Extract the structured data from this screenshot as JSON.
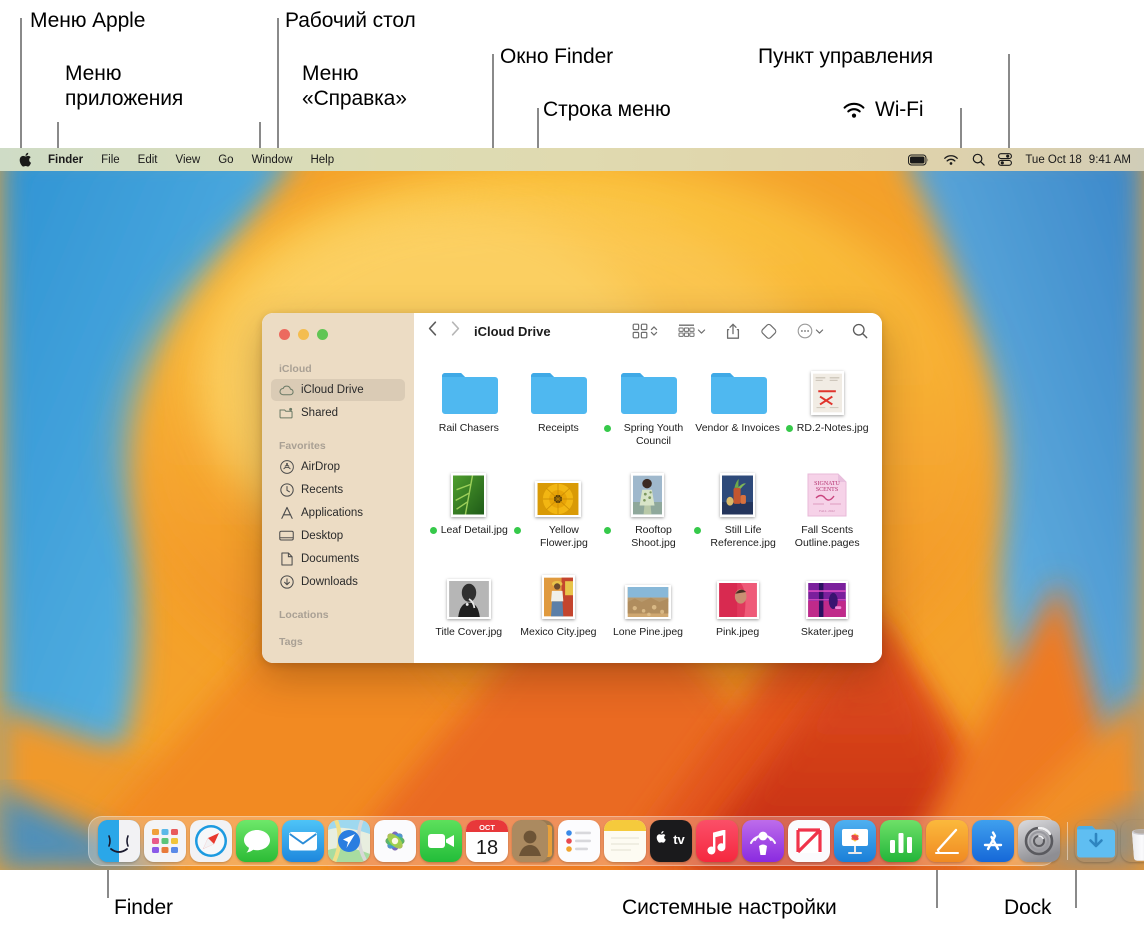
{
  "annotations": [
    {
      "id": "apple-menu",
      "text": "Меню Apple"
    },
    {
      "id": "app-menu",
      "text": "Меню\nприложения"
    },
    {
      "id": "desktop",
      "text": "Рабочий стол"
    },
    {
      "id": "help-menu",
      "text": "Меню\n«Справка»"
    },
    {
      "id": "finder-window",
      "text": "Окно Finder"
    },
    {
      "id": "menu-bar",
      "text": "Строка меню"
    },
    {
      "id": "control-center",
      "text": "Пункт управления"
    },
    {
      "id": "wifi",
      "text": "Wi-Fi"
    },
    {
      "id": "finder-dock",
      "text": "Finder"
    },
    {
      "id": "system-settings",
      "text": "Системные настройки"
    },
    {
      "id": "dock",
      "text": "Dock"
    }
  ],
  "menubar": {
    "apple_icon": "apple-logo-icon",
    "items": [
      {
        "label": "Finder",
        "bold": true
      },
      {
        "label": "File",
        "bold": false
      },
      {
        "label": "Edit",
        "bold": false
      },
      {
        "label": "View",
        "bold": false
      },
      {
        "label": "Go",
        "bold": false
      },
      {
        "label": "Window",
        "bold": false
      },
      {
        "label": "Help",
        "bold": false
      }
    ],
    "status": {
      "battery_icon": "battery-icon",
      "wifi_icon": "wifi-icon",
      "search_icon": "spotlight-search-icon",
      "control_center_icon": "control-center-icon",
      "date": "Tue Oct 18",
      "time": "9:41 AM"
    }
  },
  "finder": {
    "title": "iCloud Drive",
    "traffic_lights": [
      "close",
      "minimize",
      "zoom"
    ],
    "toolbar": {
      "back_icon": "chevron-left-icon",
      "forward_icon": "chevron-right-icon",
      "view_icon": "icon-view-icon",
      "group_icon": "group-by-icon",
      "share_icon": "share-icon",
      "tag_icon": "tag-icon",
      "more_icon": "more-ellipsis-icon",
      "search_icon": "search-icon"
    },
    "sidebar": [
      {
        "type": "header",
        "label": "iCloud"
      },
      {
        "type": "item",
        "label": "iCloud Drive",
        "icon": "cloud-icon",
        "active": true
      },
      {
        "type": "item",
        "label": "Shared",
        "icon": "shared-folder-icon",
        "active": false
      },
      {
        "type": "header",
        "label": "Favorites"
      },
      {
        "type": "item",
        "label": "AirDrop",
        "icon": "airdrop-icon",
        "active": false
      },
      {
        "type": "item",
        "label": "Recents",
        "icon": "clock-icon",
        "active": false
      },
      {
        "type": "item",
        "label": "Applications",
        "icon": "applications-icon",
        "active": false
      },
      {
        "type": "item",
        "label": "Desktop",
        "icon": "desktop-icon",
        "active": false
      },
      {
        "type": "item",
        "label": "Documents",
        "icon": "document-icon",
        "active": false
      },
      {
        "type": "item",
        "label": "Downloads",
        "icon": "downloads-icon",
        "active": false
      },
      {
        "type": "header",
        "label": "Locations"
      },
      {
        "type": "header",
        "label": "Tags"
      }
    ],
    "files": [
      {
        "name": "Rail Chasers",
        "kind": "folder",
        "badge": false
      },
      {
        "name": "Receipts",
        "kind": "folder",
        "badge": false
      },
      {
        "name": "Spring Youth Council",
        "kind": "folder",
        "badge": true
      },
      {
        "name": "Vendor & Invoices",
        "kind": "folder",
        "badge": false
      },
      {
        "name": "RD.2-Notes.jpg",
        "kind": "image-notes",
        "badge": true
      },
      {
        "name": "Leaf Detail.jpg",
        "kind": "image-leaf",
        "badge": true
      },
      {
        "name": "Yellow Flower.jpg",
        "kind": "image-flower",
        "badge": true
      },
      {
        "name": "Rooftop Shoot.jpg",
        "kind": "image-rooftop",
        "badge": true
      },
      {
        "name": "Still Life Reference.jpg",
        "kind": "image-stilllife",
        "badge": true
      },
      {
        "name": "Fall Scents Outline.pages",
        "kind": "pages-doc",
        "badge": false
      },
      {
        "name": "Title Cover.jpg",
        "kind": "image-title",
        "badge": false
      },
      {
        "name": "Mexico City.jpeg",
        "kind": "image-mexico",
        "badge": false
      },
      {
        "name": "Lone Pine.jpeg",
        "kind": "image-lonepine",
        "badge": false
      },
      {
        "name": "Pink.jpeg",
        "kind": "image-pink",
        "badge": false
      },
      {
        "name": "Skater.jpeg",
        "kind": "image-skater",
        "badge": false
      }
    ]
  },
  "dock": {
    "items": [
      {
        "name": "Finder",
        "icon": "finder-icon",
        "running": true
      },
      {
        "name": "Launchpad",
        "icon": "launchpad-icon",
        "running": false
      },
      {
        "name": "Safari",
        "icon": "safari-icon",
        "running": false
      },
      {
        "name": "Messages",
        "icon": "messages-icon",
        "running": false
      },
      {
        "name": "Mail",
        "icon": "mail-icon",
        "running": false
      },
      {
        "name": "Maps",
        "icon": "maps-icon",
        "running": false
      },
      {
        "name": "Photos",
        "icon": "photos-icon",
        "running": false
      },
      {
        "name": "FaceTime",
        "icon": "facetime-icon",
        "running": false
      },
      {
        "name": "Calendar",
        "icon": "calendar-icon",
        "running": false,
        "month": "OCT",
        "day": "18"
      },
      {
        "name": "Contacts",
        "icon": "contacts-icon",
        "running": false
      },
      {
        "name": "Reminders",
        "icon": "reminders-icon",
        "running": false
      },
      {
        "name": "Notes",
        "icon": "notes-icon",
        "running": false
      },
      {
        "name": "TV",
        "icon": "appletv-icon",
        "running": false
      },
      {
        "name": "Music",
        "icon": "music-icon",
        "running": false
      },
      {
        "name": "Podcasts",
        "icon": "podcasts-icon",
        "running": false
      },
      {
        "name": "News",
        "icon": "news-icon",
        "running": false
      },
      {
        "name": "Keynote",
        "icon": "keynote-icon",
        "running": false
      },
      {
        "name": "Numbers",
        "icon": "numbers-icon",
        "running": false
      },
      {
        "name": "Pages",
        "icon": "pages-icon",
        "running": false
      },
      {
        "name": "App Store",
        "icon": "appstore-icon",
        "running": false
      },
      {
        "name": "System Settings",
        "icon": "system-settings-icon",
        "running": false
      },
      {
        "name": "separator",
        "icon": "dock-separator",
        "running": false
      },
      {
        "name": "Downloads",
        "icon": "downloads-folder-icon",
        "running": false
      },
      {
        "name": "Trash",
        "icon": "trash-icon",
        "running": false
      }
    ]
  },
  "colors": {
    "accent_green": "#36c94a",
    "folder_blue": "#4fb8f0",
    "menubar_bg": "#dcdcb4",
    "sidebar_bg": "#ecdcc4"
  }
}
